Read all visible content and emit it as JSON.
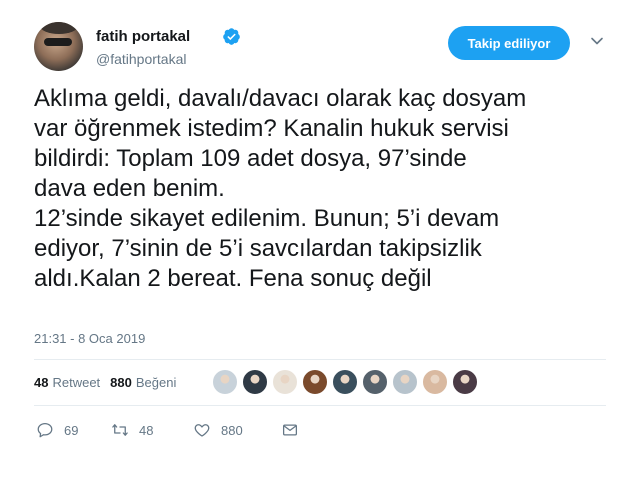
{
  "profile": {
    "name": "fatih portakal",
    "handle": "@fatihportakal"
  },
  "follow_button_label": "Takip ediliyor",
  "tweet": {
    "text": "Aklıma geldi, davalı/davacı olarak kaç dosyam\nvar öğrenmek istedim? Kanalin hukuk servisi\nbildirdi: Toplam 109 adet dosya, 97’sinde\ndava eden benim.\n12’sinde sikayet edilenim. Bunun; 5’i devam\nediyor, 7’sinin de 5’i savcılardan takipsizlik\naldı.Kalan 2 bereat. Fena sonuç değil",
    "timestamp": "21:31 - 8 Oca 2019"
  },
  "stats": {
    "retweet_count": "48",
    "retweet_label": "Retweet",
    "like_count": "880",
    "like_label": "Beğeni"
  },
  "liker_avatar_colors": [
    "#c8d2da",
    "#2f3a45",
    "#e9e2d8",
    "#7a4a2c",
    "#3a4f5d",
    "#55616b",
    "#b7c3cc",
    "#d9b9a0",
    "#4a3b45"
  ],
  "actions": {
    "reply_count": "69",
    "retweet_count": "48",
    "like_count": "880"
  },
  "colors": {
    "accent": "#1da1f2",
    "secondary_text": "#657786",
    "divider": "#e6ecf0"
  }
}
